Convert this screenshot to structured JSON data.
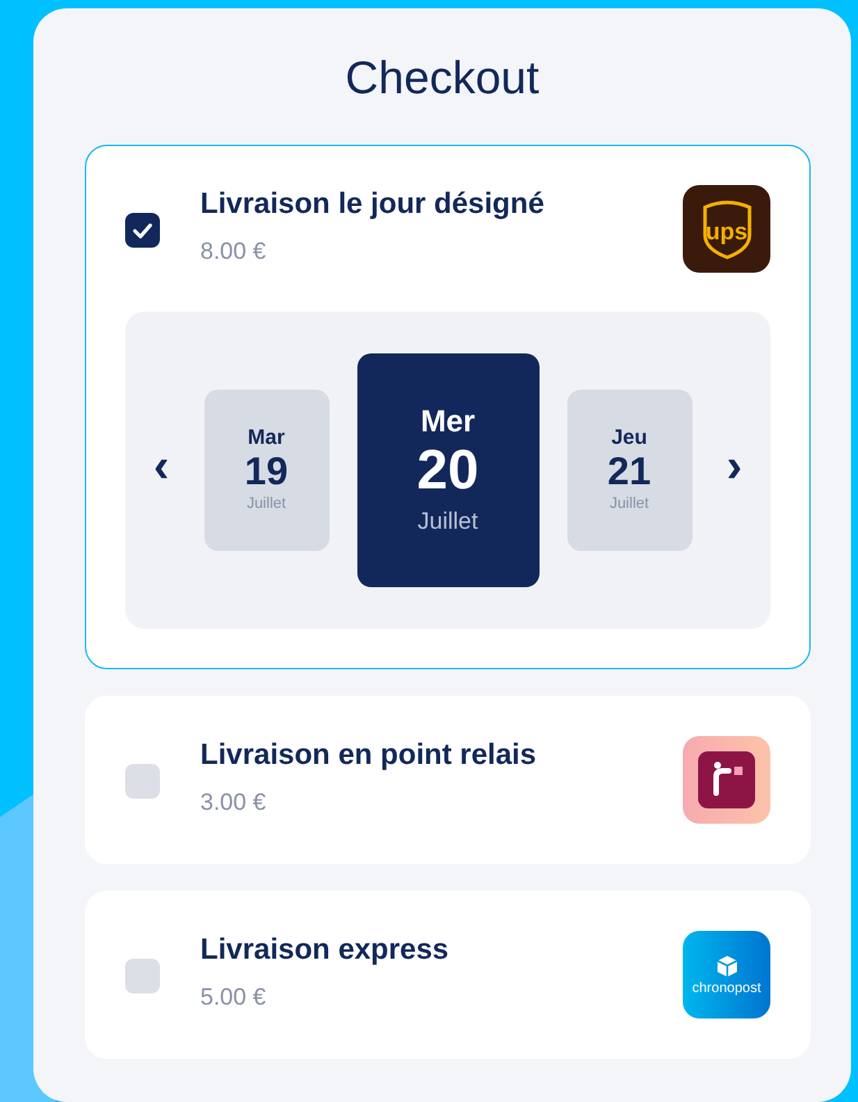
{
  "title": "Checkout",
  "options": [
    {
      "label": "Livraison le jour désigné",
      "price": "8.00 €",
      "checked": true,
      "logo": {
        "kind": "ups",
        "text": "ups"
      },
      "dates": [
        {
          "weekday": "Mar",
          "day": "19",
          "month": "Juillet",
          "selected": false
        },
        {
          "weekday": "Mer",
          "day": "20",
          "month": "Juillet",
          "selected": true
        },
        {
          "weekday": "Jeu",
          "day": "21",
          "month": "Juillet",
          "selected": false
        }
      ],
      "prev": "‹",
      "next": "›"
    },
    {
      "label": "Livraison en point relais",
      "price": "3.00 €",
      "checked": false,
      "logo": {
        "kind": "relais"
      }
    },
    {
      "label": "Livraison express",
      "price": "5.00 €",
      "checked": false,
      "logo": {
        "kind": "chrono",
        "text": "chronopost"
      }
    }
  ]
}
